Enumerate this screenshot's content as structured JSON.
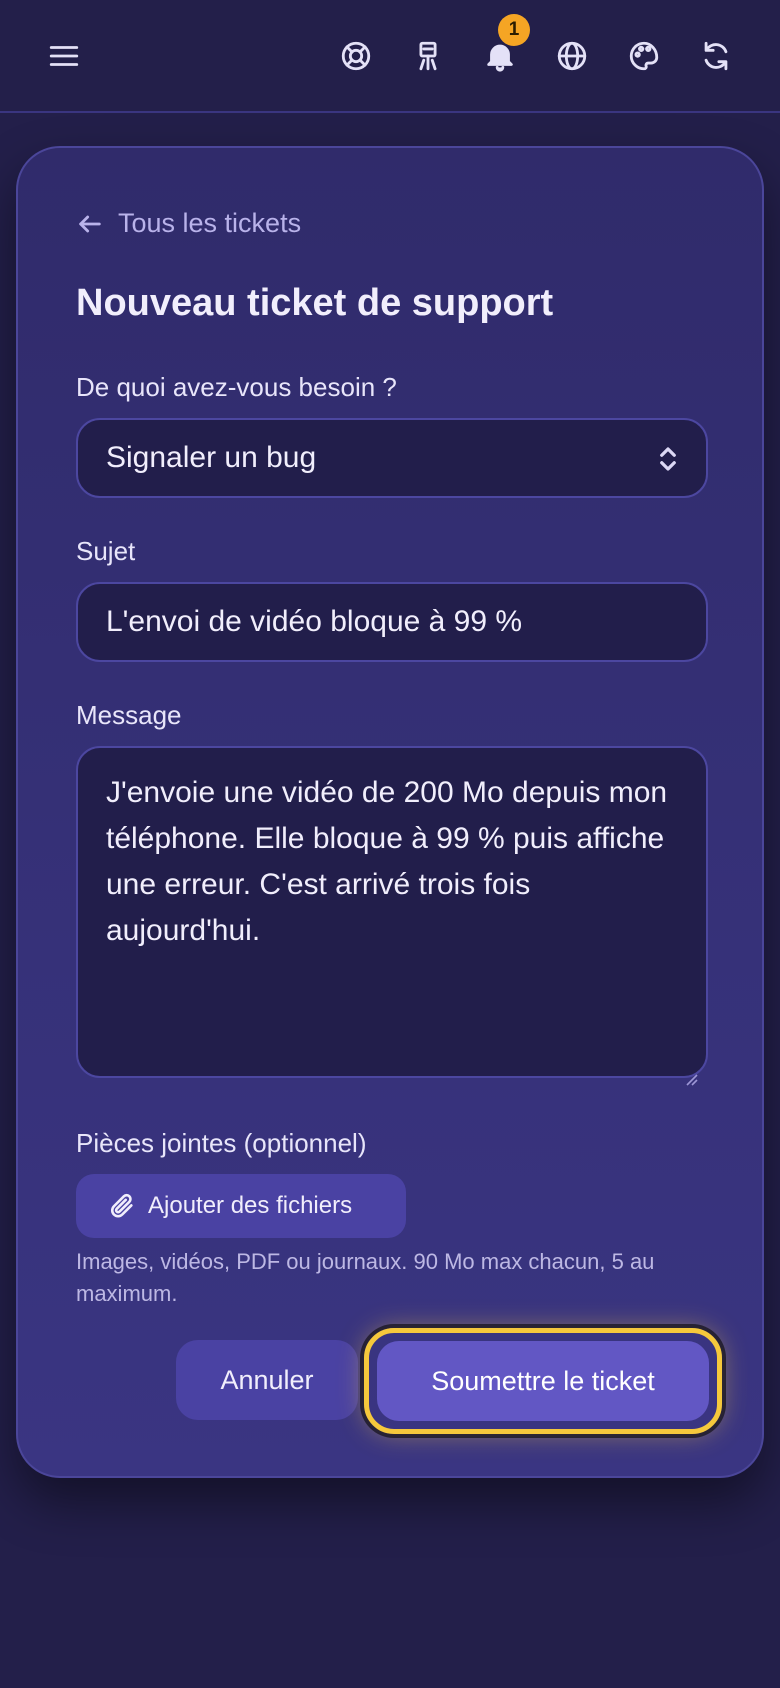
{
  "topbar": {
    "icons": [
      "menu-icon",
      "lifebuoy-icon",
      "chalkboard-icon",
      "bell-icon",
      "globe-icon",
      "palette-icon",
      "refresh-icon"
    ],
    "notification_count": "1"
  },
  "form": {
    "back_label": "Tous les tickets",
    "title": "Nouveau ticket de support",
    "type_label": "De quoi avez-vous besoin ?",
    "type_value": "Signaler un bug",
    "subject_label": "Sujet",
    "subject_value": "L'envoi de vidéo bloque à 99 %",
    "message_label": "Message",
    "message_value": "J'envoie une vidéo de 200 Mo depuis mon téléphone. Elle bloque à 99 % puis affiche une erreur. C'est arrivé trois fois aujourd'hui.",
    "attachments_label": "Pièces jointes (optionnel)",
    "attach_button": "Ajouter des fichiers",
    "attachments_hint": "Images, vidéos, PDF ou journaux. 90 Mo max chacun, 5 au maximum.",
    "cancel_button": "Annuler",
    "submit_button": "Soumettre le ticket"
  },
  "colors": {
    "background": "#231f4a",
    "card": "#332e72",
    "accent": "#6257c4",
    "highlight": "#f6c83c",
    "badge": "#f5a524"
  }
}
